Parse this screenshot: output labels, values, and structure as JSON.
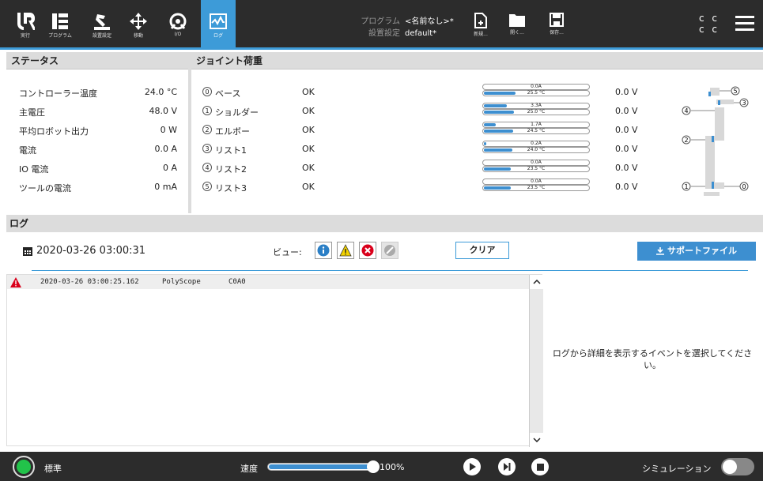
{
  "nav": [
    {
      "label": "実行",
      "icon": "ur-logo-icon"
    },
    {
      "label": "プログラム",
      "icon": "program-icon"
    },
    {
      "label": "設置設定",
      "icon": "installation-icon"
    },
    {
      "label": "移動",
      "icon": "move-icon"
    },
    {
      "label": "I/O",
      "icon": "io-icon"
    },
    {
      "label": "ログ",
      "icon": "log-icon"
    }
  ],
  "program": {
    "program_key": "プログラム",
    "program_value": "<名前なし>*",
    "install_key": "設置設定",
    "install_value": "default*"
  },
  "file_buttons": [
    {
      "label": "新規...",
      "icon": "new-file-icon"
    },
    {
      "label": "開く...",
      "icon": "open-folder-icon"
    },
    {
      "label": "保存...",
      "icon": "save-icon"
    }
  ],
  "cc": {
    "line1": "c c",
    "line2": "c c"
  },
  "status": {
    "title": "ステータス",
    "rows": [
      {
        "key": "コントローラー温度",
        "value": "24.0 °C"
      },
      {
        "key": "主電圧",
        "value": "48.0 V"
      },
      {
        "key": "平均ロボット出力",
        "value": "0 W"
      },
      {
        "key": "電流",
        "value": "0.0 A"
      },
      {
        "key": "IO 電流",
        "value": "0 A"
      },
      {
        "key": "ツールの電流",
        "value": "0 mA"
      }
    ]
  },
  "joints": {
    "title": "ジョイント荷重",
    "rows": [
      {
        "num": "0",
        "name": "ベース",
        "status": "OK",
        "current": "0.0A",
        "temp": "25.5 °C",
        "current_fraction": 0.0,
        "temp_fraction": 0.3,
        "voltage": "0.0 V"
      },
      {
        "num": "1",
        "name": "ショルダー",
        "status": "OK",
        "current": "3.3A",
        "temp": "25.0 °C",
        "current_fraction": 0.22,
        "temp_fraction": 0.29,
        "voltage": "0.0 V"
      },
      {
        "num": "2",
        "name": "エルボー",
        "status": "OK",
        "current": "1.7A",
        "temp": "24.5 °C",
        "current_fraction": 0.11,
        "temp_fraction": 0.28,
        "voltage": "0.0 V"
      },
      {
        "num": "3",
        "name": "リスト1",
        "status": "OK",
        "current": "0.2A",
        "temp": "24.0 °C",
        "current_fraction": 0.02,
        "temp_fraction": 0.27,
        "voltage": "0.0 V"
      },
      {
        "num": "4",
        "name": "リスト2",
        "status": "OK",
        "current": "0.0A",
        "temp": "23.5 °C",
        "current_fraction": 0.0,
        "temp_fraction": 0.26,
        "voltage": "0.0 V"
      },
      {
        "num": "5",
        "name": "リスト3",
        "status": "OK",
        "current": "0.0A",
        "temp": "23.5 °C",
        "current_fraction": 0.0,
        "temp_fraction": 0.26,
        "voltage": "0.0 V"
      }
    ],
    "diagram_labels": [
      "5",
      "3",
      "4",
      "2",
      "1",
      "0"
    ]
  },
  "log": {
    "title": "ログ",
    "date": "2020-03-26 03:00:31",
    "view_label": "ビュー:",
    "clear_label": "クリア",
    "support_label": "サポートファイル",
    "entry": {
      "time": "2020-03-26 03:00:25.162",
      "source": "PolyScope",
      "code": "C0A0"
    },
    "detail_placeholder": "ログから詳細を表示するイベントを選択してください。"
  },
  "bottom": {
    "power_label": "標準",
    "speed_label": "速度",
    "speed_value": "100%",
    "speed_fraction": 1.0,
    "sim_label": "シミュレーション"
  },
  "colors": {
    "accent": "#3d9bd8",
    "topbar": "#2c2c2c",
    "power_on": "#22c34a",
    "warning": "#d9001b"
  }
}
